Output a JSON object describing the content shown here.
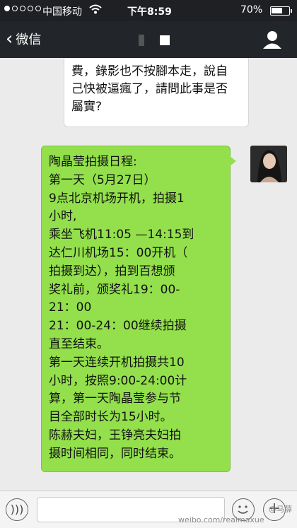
{
  "status_bar": {
    "carrier": "中国移动",
    "time": "下午8:59",
    "battery": "70%",
    "battery_level": 0.7
  },
  "nav": {
    "back_label": "微信"
  },
  "messages": [
    {
      "side": "left",
      "text": "費，錄影也不按腳本走，說自己快被逼瘋了，請問此事是否屬實?"
    },
    {
      "side": "right",
      "lines": [
        "陶晶莹拍摄日程:",
        "第一天（5月27日）",
        "9点北京机场开机，拍摄1",
        "小时,",
        "乘坐飞机11:05 —14:15到",
        "达仁川机场15：00开机（",
        "拍摄到达），拍到百想颁",
        "奖礼前，颁奖礼19：00-",
        "21：00",
        "21：00-24：00继续拍摄",
        "直至结束。",
        "第一天连续开机拍摄共10",
        "小时，按照9:00-24:00计",
        "算，第一天陶晶莹参与节",
        "目全部时长为15小时。",
        "陈赫夫妇，王铮亮夫妇拍",
        "摄时间相同，同时结束。"
      ]
    }
  ],
  "watermark": "weibo.com/realmaxue",
  "watermark_top": "@马薛",
  "colors": {
    "outgoing_bubble": "#93e04c",
    "header": "#22262a"
  }
}
